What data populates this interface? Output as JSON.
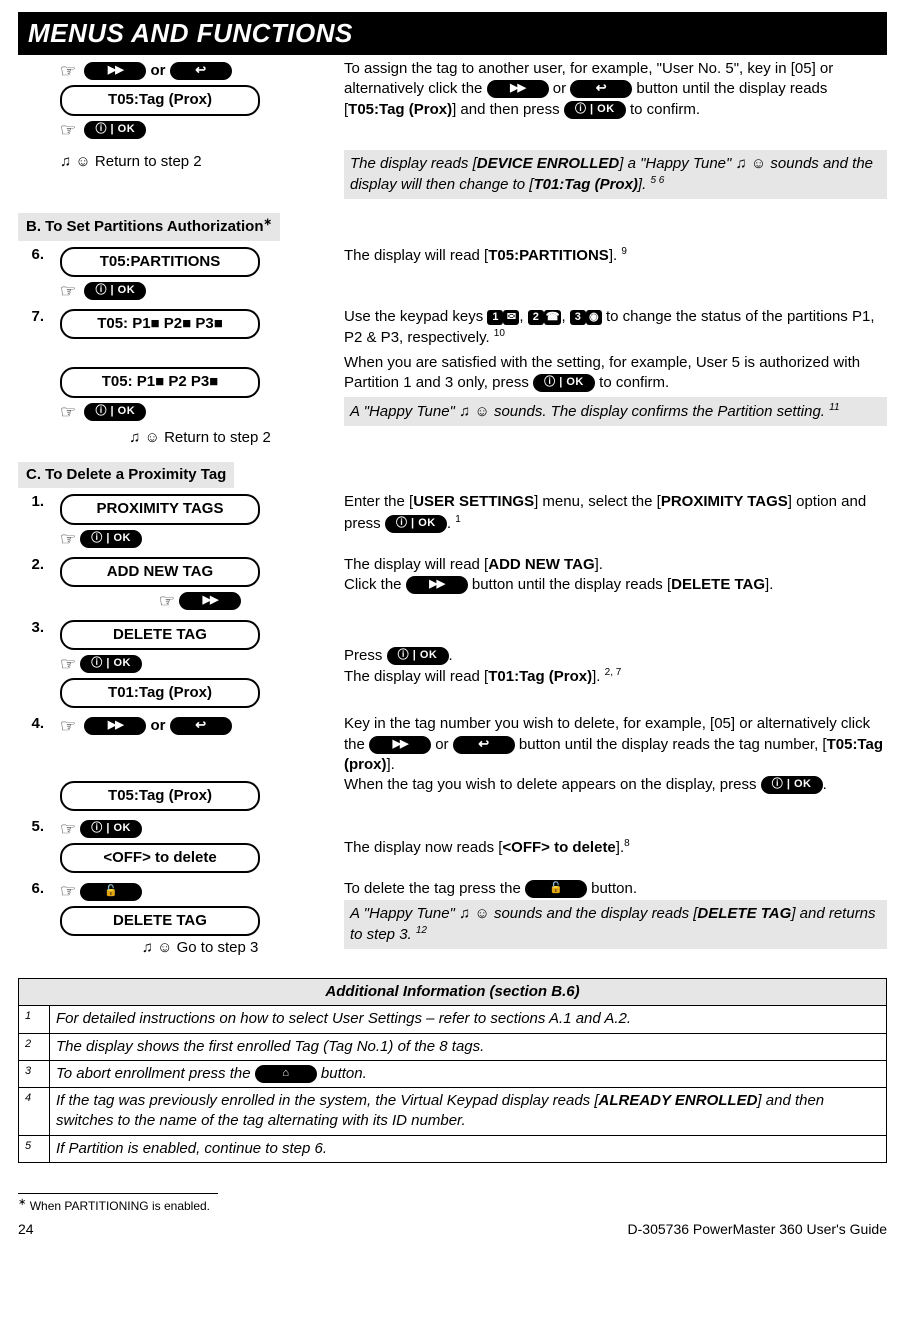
{
  "header": "MENUS AND FUNCTIONS",
  "sec_a": {
    "or": "or",
    "lcd1": "T05:Tag (Prox)",
    "return": "Return to step 2",
    "para1a": "To assign the tag to another user, for example, \"User No. 5\", key in [05] or alternatively click the ",
    "para1b": " or ",
    "para1c": " button until the display reads [",
    "para1_bold": "T05:Tag (Prox)",
    "para1d": "] and then press ",
    "para1e": " to confirm.",
    "gray1a": "The display reads [",
    "gray1_bold1": "DEVICE ENROLLED",
    "gray1b": "] a \"Happy Tune\" ",
    "gray1c": " sounds and the display will then change to [",
    "gray1_bold2": "T01:Tag (Prox)",
    "gray1d": "]. ",
    "gray1_sup": "5 6"
  },
  "sec_b": {
    "heading": "B. To Set Partitions Authorization",
    "star": "∗",
    "step6": "6.",
    "lcd6": "T05:PARTITIONS",
    "text6a": "The display will read [",
    "text6_bold": "T05:PARTITIONS",
    "text6b": "]. ",
    "text6_sup": "9",
    "step7": "7.",
    "lcd7a": "T05: P1■   P2■   P3■",
    "text7a": "Use the keypad keys ",
    "k1a": "1",
    "k1b": "✉",
    "k2a": "2",
    "k2b": "☎",
    "k3a": "3",
    "k3b": "◉",
    "text7b": " to change the status of the partitions P1, P2 & P3, respectively. ",
    "text7_sup": "10",
    "lcd7b": "T05: P1■   P2     P3■",
    "text7c": "When you are satisfied with the setting, for example, User 5 is authorized with Partition 1 and 3 only, press ",
    "text7d": " to confirm.",
    "return": "Return to step 2",
    "gray": "A \"Happy Tune\" ",
    "gray2": " sounds. The display confirms the Partition setting. ",
    "gray_sup": "11"
  },
  "sec_c": {
    "heading": "C. To Delete a Proximity Tag",
    "s1": "1.",
    "lcd1": "PROXIMITY TAGS",
    "t1a": "Enter the [",
    "t1b1": "USER SETTINGS",
    "t1c": "] menu, select the [",
    "t1b2": "PROXIMITY TAGS",
    "t1d": "] option and press ",
    "t1e": ". ",
    "t1_sup": "1",
    "s2": "2.",
    "lcd2": "ADD NEW TAG",
    "t2a": "The display will read [",
    "t2b": "ADD NEW TAG",
    "t2c": "].",
    "t2d": "Click the ",
    "t2e": " button until the display reads [",
    "t2f": "DELETE TAG",
    "t2g": "].",
    "s3": "3.",
    "lcd3": "DELETE TAG",
    "t3a": "Press ",
    "t3b": ".",
    "lcd3b": "T01:Tag (Prox)",
    "t3c": "The display will read [",
    "t3d": "T01:Tag (Prox)",
    "t3e": "]. ",
    "t3_sup": "2, 7",
    "s4": "4.",
    "or": "or",
    "t4a": "Key in the tag number you wish to delete, for example, [05] or alternatively click the ",
    "t4b": " or ",
    "t4c": " button until the display reads the tag number, [",
    "t4d": "T05:Tag (prox)",
    "t4e": "].",
    "lcd4": "T05:Tag (Prox)",
    "t4f": "When the tag you wish to delete appears on the display, press ",
    "t4g": ".",
    "s5": "5.",
    "lcd5": "<OFF> to delete",
    "t5a": "The display now reads [",
    "t5b": "<OFF> to delete",
    "t5c": "].",
    "t5_sup": "8",
    "s6": "6.",
    "t6a": "To delete the tag press the ",
    "t6b": " button.",
    "lcd6": "DELETE TAG",
    "gray_a": "A \"Happy Tune\" ",
    "gray_b": " sounds and the display reads [",
    "gray_c": "DELETE TAG",
    "gray_d": "] and returns to step 3. ",
    "gray_sup": "12",
    "goto": "Go to step 3"
  },
  "info": {
    "title": "Additional Information (section B.6)",
    "r1n": "1",
    "r1": "For detailed instructions on how to select User Settings – refer to sections A.1 and A.2.",
    "r2n": "2",
    "r2": "The display shows the first enrolled Tag (Tag No.1) of the 8 tags.",
    "r3n": "3",
    "r3a": "To abort enrollment press the ",
    "r3b": " button.",
    "r4n": "4",
    "r4a": "If the tag was previously enrolled in the system, the Virtual Keypad display reads [",
    "r4b": "ALREADY ENROLLED",
    "r4c": "] and then switches to the name of the tag alternating with its ID number.",
    "r5n": "5",
    "r5": "If Partition is enabled, continue to step 6."
  },
  "footnote": {
    "star": "∗",
    "text": " When PARTITIONING is enabled."
  },
  "footer": {
    "page": "24",
    "doc": "D-305736 PowerMaster 360 User's Guide"
  }
}
